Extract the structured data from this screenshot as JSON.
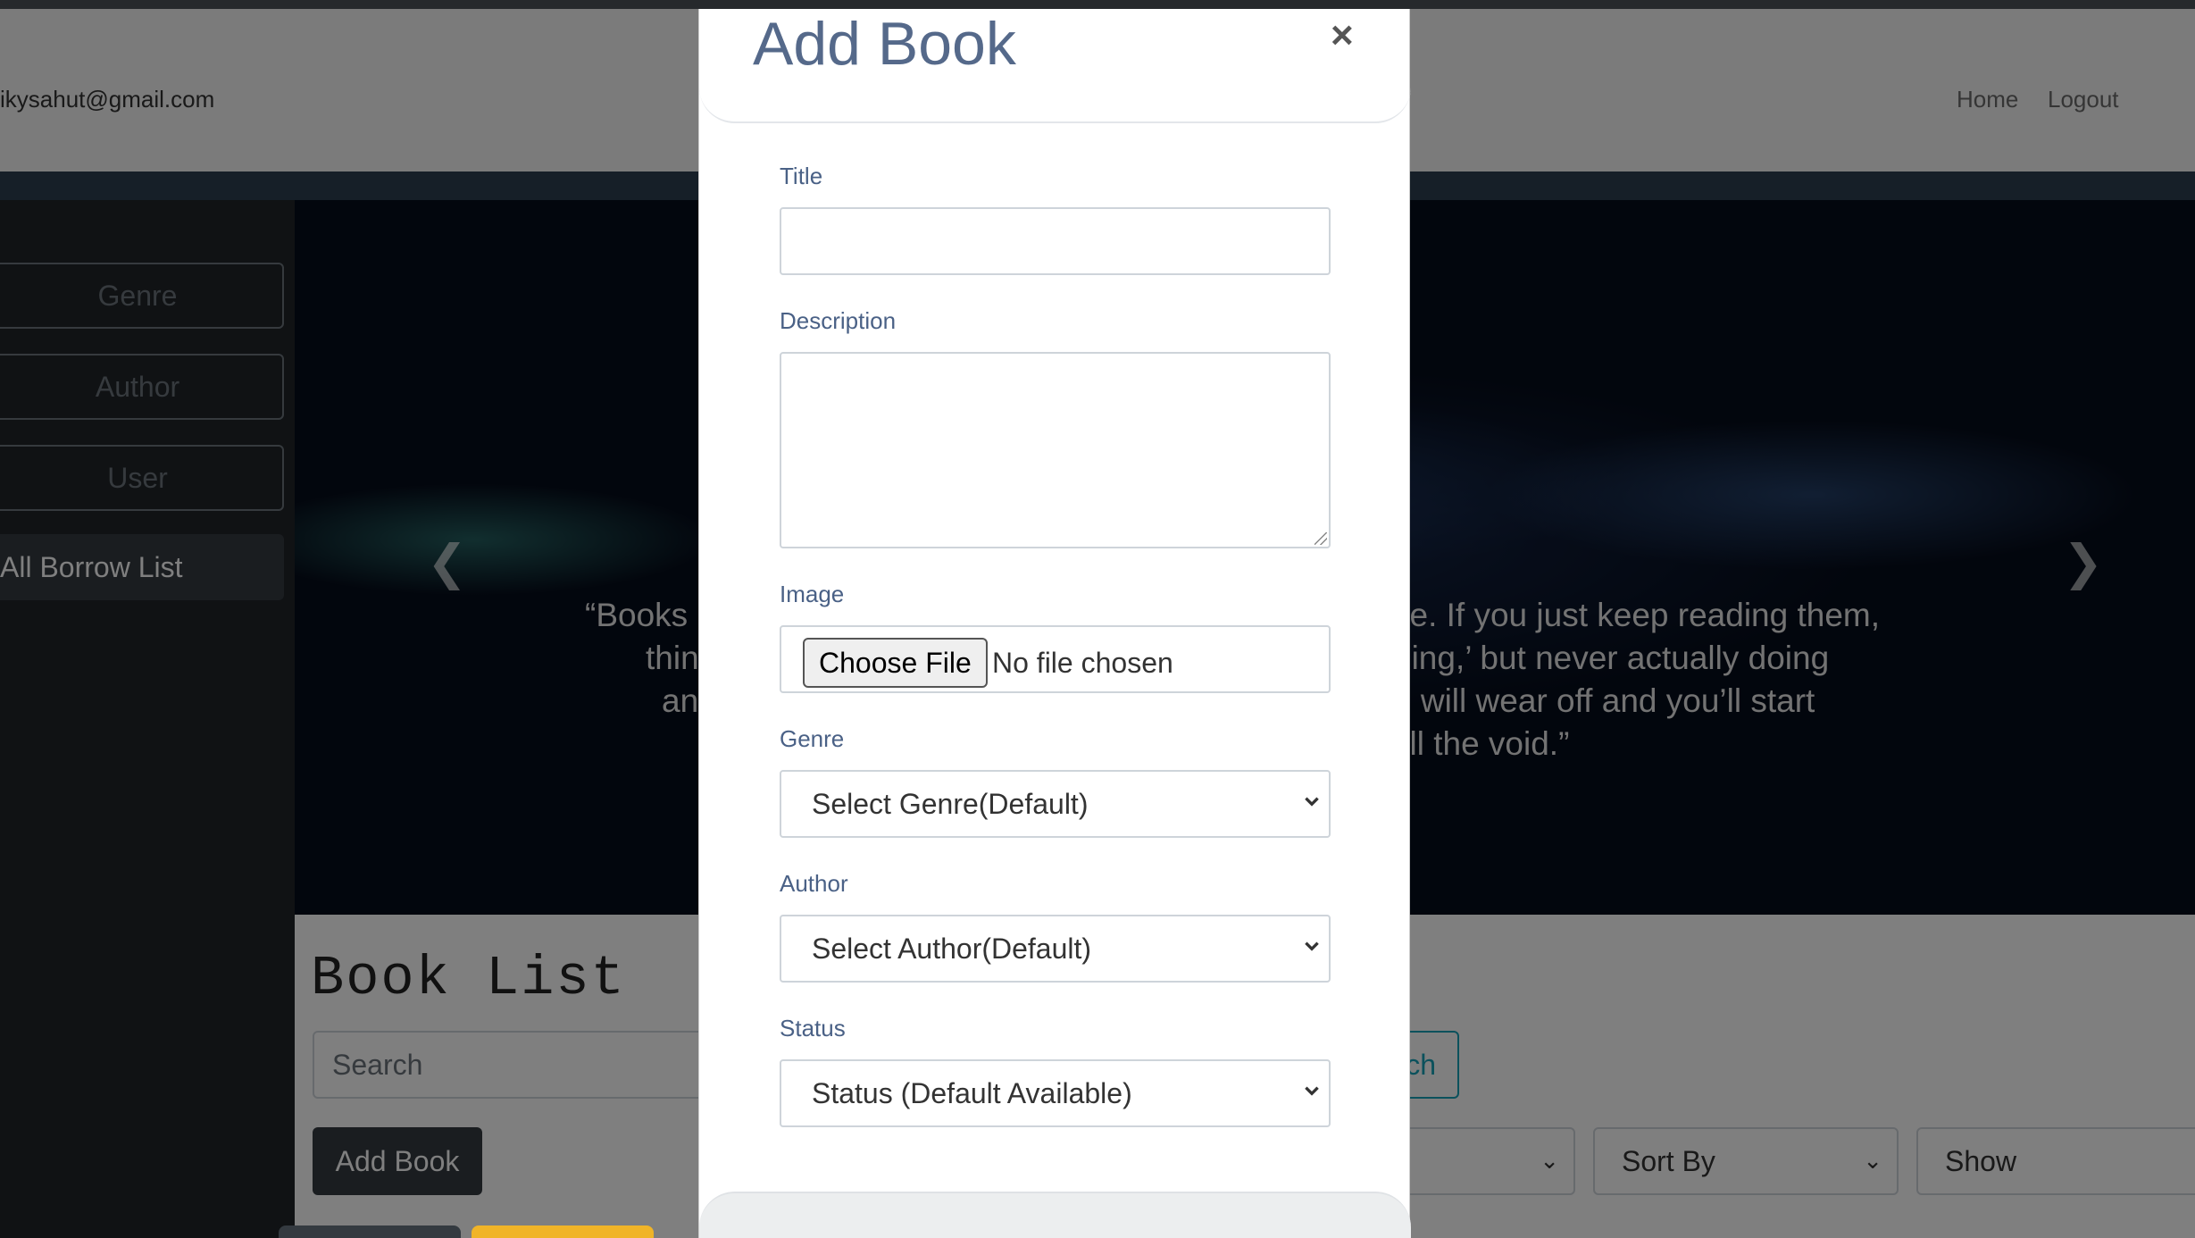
{
  "navbar": {
    "email": "ikysahut@gmail.com",
    "links": [
      "Home",
      "Logout"
    ]
  },
  "sidebar": {
    "items": [
      "Genre",
      "Author",
      "User",
      "All Borrow List"
    ]
  },
  "hero": {
    "quote_left": [
      "“Books",
      "thin",
      "an"
    ],
    "quote_right": [
      "ce. If you just keep reading them,",
      "hing,’ but never actually doing",
      "g will wear off and you’ll start",
      "fill the void.”"
    ]
  },
  "main": {
    "title": "Book List",
    "search_placeholder": "Search",
    "search_button": "ch",
    "add_book_button": "Add Book",
    "selects": [
      "",
      "Sort By",
      "Show"
    ]
  },
  "modal": {
    "title": "Add Book",
    "close": "×",
    "labels": {
      "title": "Title",
      "description": "Description",
      "image": "Image",
      "genre": "Genre",
      "author": "Author",
      "status": "Status"
    },
    "file_button": "Choose File",
    "file_status": "No file chosen",
    "genre_select": "Select Genre(Default)",
    "author_select": "Select Author(Default)",
    "status_select": "Status (Default Available)"
  }
}
